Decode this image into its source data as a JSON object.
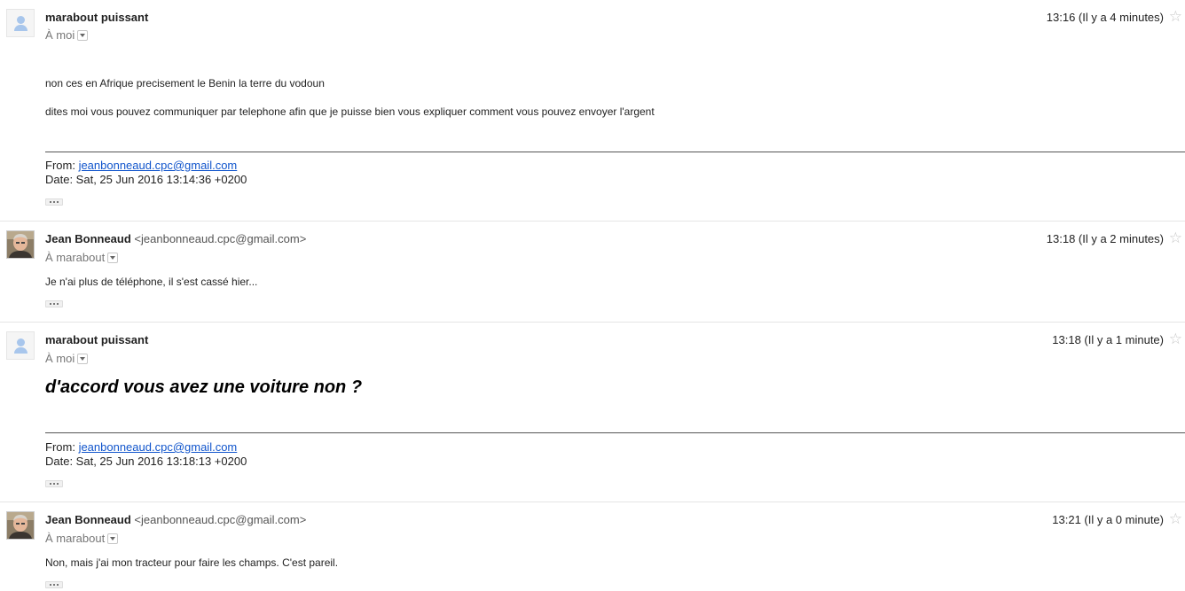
{
  "messages": [
    {
      "sender_name": "marabout puissant",
      "recipient": "À moi",
      "time": "13:16 (Il y a 4 minutes)",
      "body": [
        "non ces en Afrique precisement le Benin la terre du vodoun",
        "dites moi vous pouvez communiquer par telephone afin que je puisse bien vous expliquer  comment vous pouvez envoyer l'argent"
      ],
      "quoted": {
        "from_label": "From: ",
        "from_email": "jeanbonneaud.cpc@gmail.com",
        "date": "Date: Sat, 25 Jun 2016 13:14:36 +0200"
      }
    },
    {
      "sender_name": "Jean Bonneaud",
      "sender_email": "<jeanbonneaud.cpc@gmail.com>",
      "recipient": "À marabout",
      "time": "13:18 (Il y a 2 minutes)",
      "body": [
        "Je n'ai plus de téléphone, il s'est cassé hier..."
      ]
    },
    {
      "sender_name": "marabout puissant",
      "recipient": "À moi",
      "time": "13:18 (Il y a 1 minute)",
      "body": [
        "d'accord vous avez une voiture non ?"
      ],
      "quoted": {
        "from_label": "From: ",
        "from_email": "jeanbonneaud.cpc@gmail.com",
        "date": "Date: Sat, 25 Jun 2016 13:18:13 +0200"
      }
    },
    {
      "sender_name": "Jean Bonneaud",
      "sender_email": "<jeanbonneaud.cpc@gmail.com>",
      "recipient": "À marabout",
      "time": "13:21 (Il y a 0 minute)",
      "body": [
        "Non, mais j'ai mon tracteur pour faire les champs. C'est pareil."
      ]
    }
  ],
  "icons": {
    "star": "star-icon",
    "dropdown": "chevron-down-icon",
    "default_avatar": "default-avatar-icon",
    "more": "more-horizontal-icon"
  },
  "colors": {
    "link": "#1155cc",
    "star": "#c8c8c8",
    "separator": "#e5e5e5"
  }
}
